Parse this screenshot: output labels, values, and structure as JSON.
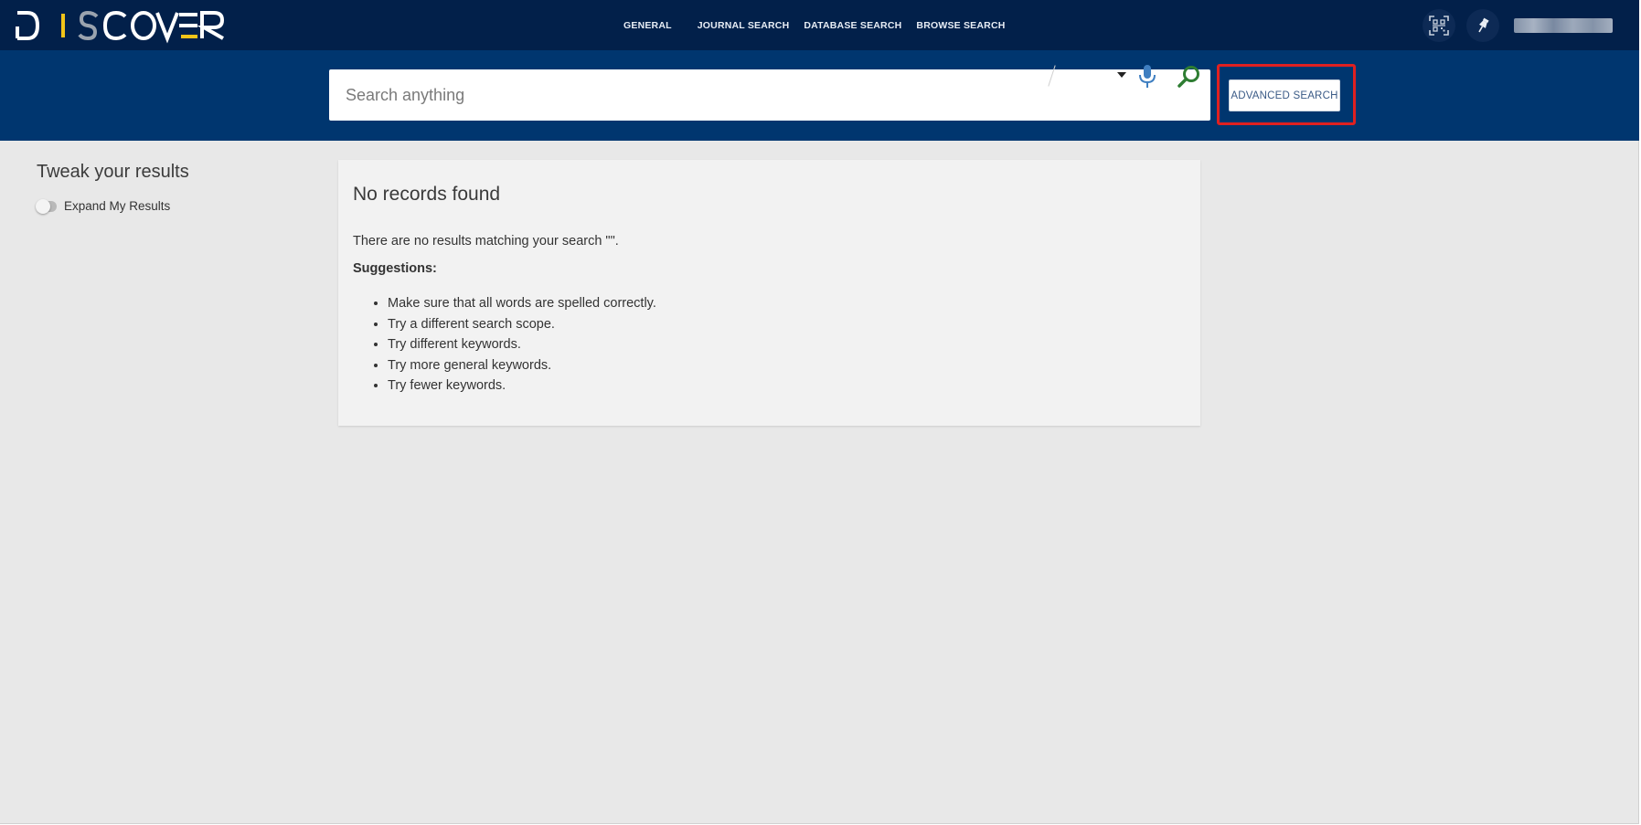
{
  "header": {
    "logo_alt": "DISCOVER",
    "nav": [
      {
        "label": "GENERAL"
      },
      {
        "label": "JOURNAL SEARCH"
      },
      {
        "label": "DATABASE SEARCH"
      },
      {
        "label": "BROWSE SEARCH"
      }
    ],
    "icons": {
      "qr": "qr-code-icon",
      "pin": "pin-icon"
    },
    "user_name": ""
  },
  "search": {
    "placeholder": "Search anything",
    "value": "",
    "scope": "",
    "advanced_label": "ADVANCED SEARCH"
  },
  "sidebar": {
    "title": "Tweak your results",
    "toggle_label": "Expand My Results",
    "toggle_on": false
  },
  "results": {
    "heading": "No records found",
    "message": "There are no results matching your search \"\".",
    "suggestions_title": "Suggestions:",
    "suggestions": [
      "Make sure that all words are spelled correctly.",
      "Try a different search scope.",
      "Try different keywords.",
      "Try more general keywords.",
      "Try fewer keywords."
    ]
  },
  "colors": {
    "topbar": "#02204a",
    "searchband": "#00366f",
    "highlight": "#e02020",
    "search_icon": "#2e7d32",
    "mic_icon": "#3f7fc1",
    "logo_accent": "#f2c418"
  }
}
